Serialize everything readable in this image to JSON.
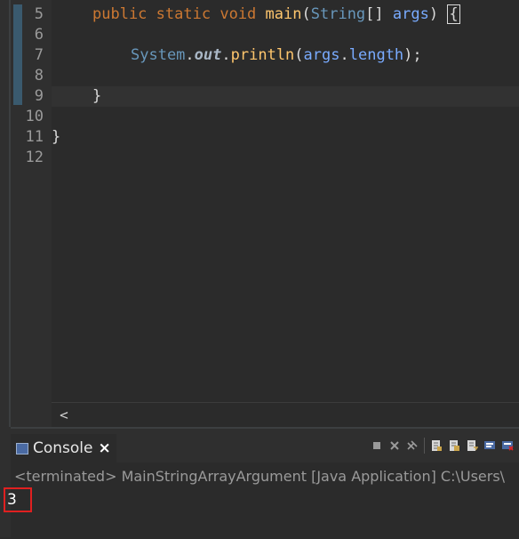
{
  "editor": {
    "lines": [
      {
        "number": "5",
        "fold": true
      },
      {
        "number": "6"
      },
      {
        "number": "7"
      },
      {
        "number": "8"
      },
      {
        "number": "9"
      },
      {
        "number": "10"
      },
      {
        "number": "11"
      },
      {
        "number": "12"
      }
    ],
    "code": {
      "line5": {
        "kw1": "public",
        "kw2": "static",
        "kw3": "void",
        "method": "main",
        "open": "(",
        "type": "String",
        "brackets": "[]",
        "param": "args",
        "close": ")",
        "brace": "{"
      },
      "line7": {
        "class": "System",
        "dot1": ".",
        "field": "out",
        "dot2": ".",
        "method": "println",
        "open": "(",
        "arg": "args",
        "dot3": ".",
        "member": "length",
        "end": ");"
      },
      "line9": {
        "brace": "}"
      },
      "line11": {
        "brace": "}"
      }
    }
  },
  "scrollbar": {
    "left_arrow": "<"
  },
  "console": {
    "tab_label": "Console",
    "close_glyph": "×",
    "status": "<terminated> MainStringArrayArgument [Java Application] C:\\Users\\",
    "output": "3",
    "toolbar_icons": [
      "terminate-icon",
      "remove-launch-icon",
      "remove-all-terminated-icon",
      "scroll-lock-icon",
      "show-console-on-output-icon",
      "word-wrap-icon",
      "pin-console-icon",
      "display-selected-console-icon"
    ]
  },
  "colors": {
    "highlight": "#e02020",
    "keyword": "#cc7832",
    "method": "#ffc66d",
    "type": "#6897bb",
    "param": "#79abff"
  }
}
